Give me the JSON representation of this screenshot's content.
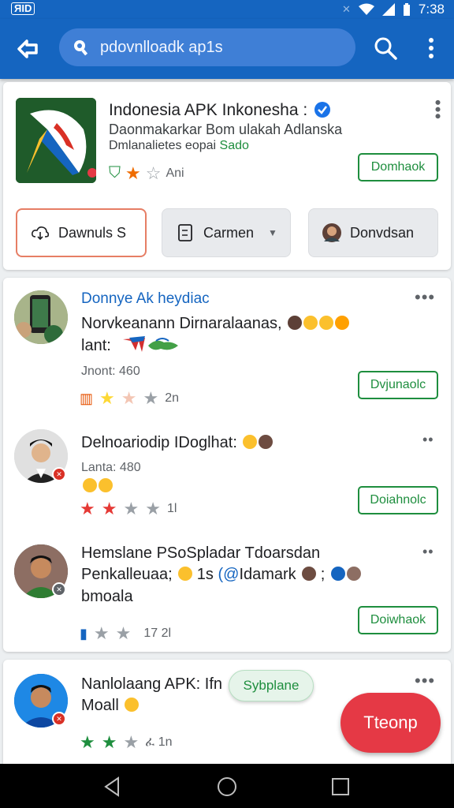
{
  "status_bar": {
    "left_badge": "ЯID",
    "time": "7:38"
  },
  "app_bar": {
    "search_text": "pdovnlloadk ap1s"
  },
  "app": {
    "title": "Indonesia APK Inkonesha :",
    "desc_line1": "Daonmakarkar Bom ulakah Adlanska",
    "desc_line2": "Dmlanalietes eopai",
    "desc_line2_green": "Sado",
    "meta_label": "Ani",
    "download_label": "Domhaok",
    "chips": [
      {
        "label": "Dawnuls S"
      },
      {
        "label": "Carmen"
      },
      {
        "label": "Donvdsan"
      }
    ]
  },
  "reviews": [
    {
      "name": "Donnye Ak heydiac",
      "text1": "Norvkeanann Dirnaralaanas,",
      "text2": "lant:",
      "sub": "Jnont: 460",
      "rating_label": "2n",
      "download_label": "Dvjunaolc"
    },
    {
      "name": "Delnoariodip IDoglhat:",
      "sub": "Lanta: 480",
      "rating_label": "1l",
      "download_label": "Doiahnolc"
    },
    {
      "name": "Hemslane PSoSpladar Tdoarsdan",
      "text1": "Penkalleuaa;",
      "text1b": "1s",
      "text1c": "Idamark",
      "text2": "bmoala",
      "rating_label": "17 2l",
      "download_label": "Doiwhaok"
    },
    {
      "name": "Nanlolaang APK: Ifn",
      "text1": "Moall",
      "rating_label": "1n"
    }
  ],
  "toast_label": "Sybplane",
  "fab_label": "Tteonp",
  "colors": {
    "primary": "#1565c0",
    "accent_green": "#1e8e3e",
    "fab_red": "#e53945"
  }
}
